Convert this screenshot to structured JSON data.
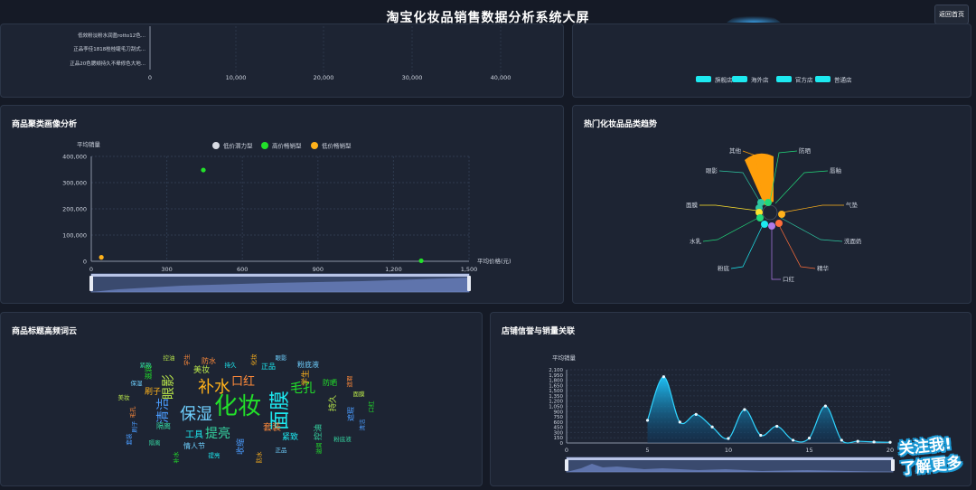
{
  "header": {
    "title": "淘宝化妆品销售数据分析系统大屏",
    "back_label": "返回首页"
  },
  "top_left": {
    "items": [
      "低效粉淡粉水润盈rotto12色...",
      "正品李佳1818桂桂睫毛刀刮式...",
      "正品20色腮颊持久不晕修色大地..."
    ],
    "x_ticks": [
      "0",
      "10,000",
      "20,000",
      "30,000",
      "40,000"
    ]
  },
  "top_right": {
    "legend": [
      "旗舰店",
      "海外店",
      "官方店",
      "普通店"
    ],
    "legend_color": "#1de9f0"
  },
  "scatter": {
    "title": "商品聚类画像分析",
    "ylabel": "平均销量",
    "xlabel": "平均价格(元)",
    "legend": [
      {
        "name": "低价潜力型",
        "color": "#d8dce4"
      },
      {
        "name": "高价畅销型",
        "color": "#22e02a"
      },
      {
        "name": "低价畅销型",
        "color": "#ffb21b"
      }
    ],
    "y_ticks": [
      "400,000",
      "300,000",
      "200,000",
      "100,000",
      "0"
    ],
    "x_ticks": [
      "0",
      "300",
      "600",
      "900",
      "1,200",
      "1,500"
    ]
  },
  "trend": {
    "title": "热门化妆品品类趋势",
    "labels": [
      "其他",
      "防晒",
      "眼影",
      "唇釉",
      "面膜",
      "气垫",
      "水乳",
      "洗面奶",
      "粉底",
      "精华",
      "口红"
    ]
  },
  "wordcloud": {
    "title": "商品标题高频词云",
    "words": [
      "化妆",
      "面膜",
      "补水",
      "保湿",
      "口红",
      "眼影",
      "清洁",
      "提亮",
      "毛孔",
      "工具",
      "学生",
      "粉底液",
      "防水",
      "美妆",
      "收缩",
      "控油",
      "滋润",
      "正品",
      "刷子",
      "情人节",
      "套装",
      "持久",
      "遮瑕",
      "隔离",
      "防晒",
      "紧致"
    ]
  },
  "shop": {
    "title": "店铺信誉与销量关联",
    "ylabel": "平均销量",
    "y_ticks": [
      "2,100",
      "1,950",
      "1,800",
      "1,650",
      "1,500",
      "1,350",
      "1,200",
      "1,050",
      "900",
      "750",
      "600",
      "450",
      "300",
      "150",
      "0"
    ],
    "y_tick_values": [
      2100,
      1950,
      1800,
      1650,
      1500,
      1350,
      1200,
      1050,
      900,
      750,
      600,
      450,
      300,
      150,
      0
    ],
    "x_ticks": [
      "0",
      "5",
      "10",
      "15",
      "20"
    ],
    "xlabel_partial": "店"
  },
  "badge": {
    "line1": "关注我!",
    "line2": "了解更多"
  },
  "chart_data": [
    {
      "type": "scatter",
      "title": "商品聚类画像分析",
      "xlabel": "平均价格(元)",
      "ylabel": "平均销量",
      "xlim": [
        0,
        1500
      ],
      "ylim": [
        0,
        400000
      ],
      "grid": true,
      "legend_position": "top-center",
      "series": [
        {
          "name": "低价潜力型",
          "color": "#d8dce4",
          "points": []
        },
        {
          "name": "高价畅销型",
          "color": "#22e02a",
          "points": [
            [
              445,
              348000
            ],
            [
              1310,
              2000
            ]
          ]
        },
        {
          "name": "低价畅销型",
          "color": "#ffb21b",
          "points": [
            [
              40,
              15000
            ]
          ]
        }
      ]
    },
    {
      "type": "area",
      "title": "店铺信誉与销量关联",
      "ylabel": "平均销量",
      "xlim": [
        0,
        20
      ],
      "ylim": [
        0,
        2100
      ],
      "x": [
        5,
        6,
        7,
        8,
        9,
        10,
        11,
        12,
        13,
        14,
        15,
        16,
        17,
        18,
        19,
        20
      ],
      "values": [
        650,
        1900,
        600,
        820,
        460,
        130,
        960,
        220,
        480,
        80,
        140,
        1060,
        80,
        50,
        30,
        20
      ]
    },
    {
      "type": "bar",
      "title": "热门化妆品品类趋势",
      "categories": [
        "其他",
        "防晒",
        "唇釉",
        "气垫",
        "洗面奶",
        "精华",
        "口红",
        "粉底",
        "水乳",
        "面膜",
        "眼影"
      ],
      "values": [
        95,
        8,
        6,
        6,
        4,
        5,
        4,
        4,
        4,
        10,
        9
      ]
    }
  ]
}
